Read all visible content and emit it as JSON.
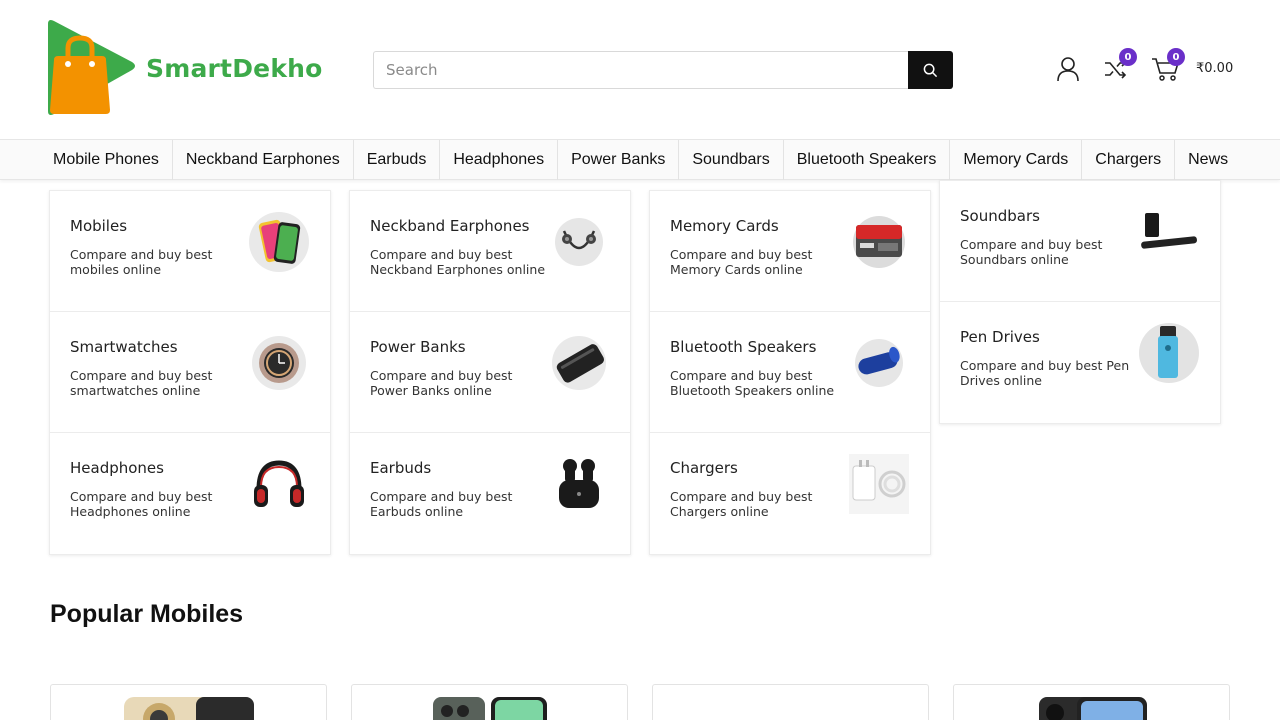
{
  "brand": {
    "name": "SmartDekho",
    "color": "#3daa4a",
    "accent": "#f39200"
  },
  "search": {
    "placeholder": "Search",
    "value": ""
  },
  "header": {
    "compare_count": "0",
    "cart_count": "0",
    "cart_total": "₹0.00",
    "badge_color": "#6a2fc9"
  },
  "nav": {
    "items": [
      "Mobile Phones",
      "Neckband Earphones",
      "Earbuds",
      "Headphones",
      "Power Banks",
      "Soundbars",
      "Bluetooth Speakers",
      "Memory Cards",
      "Chargers",
      "News"
    ]
  },
  "categories": {
    "col1": [
      {
        "title": "Mobiles",
        "desc": "Compare and buy best mobiles online",
        "icon": "mobile-phone-icon"
      },
      {
        "title": "Smartwatches",
        "desc": "Compare and buy best smartwatches online",
        "icon": "smartwatch-icon"
      },
      {
        "title": "Headphones",
        "desc": "Compare and buy best Headphones online",
        "icon": "headphones-icon"
      }
    ],
    "col2": [
      {
        "title": "Neckband Earphones",
        "desc": "Compare and buy best Neckband Earphones online",
        "icon": "neckband-icon"
      },
      {
        "title": "Power Banks",
        "desc": "Compare and buy best Power Banks online",
        "icon": "power-bank-icon"
      },
      {
        "title": "Earbuds",
        "desc": "Compare and buy best Earbuds online",
        "icon": "earbuds-icon"
      }
    ],
    "col3": [
      {
        "title": "Memory Cards",
        "desc": "Compare and buy best Memory Cards online",
        "icon": "memory-card-icon"
      },
      {
        "title": "Bluetooth Speakers",
        "desc": "Compare and buy best Bluetooth Speakers online",
        "icon": "speaker-icon"
      },
      {
        "title": "Chargers",
        "desc": "Compare and buy best Chargers online",
        "icon": "charger-icon"
      }
    ],
    "col4": [
      {
        "title": "Soundbars",
        "desc": "Compare and buy best Soundbars online",
        "icon": "soundbar-icon"
      },
      {
        "title": "Pen Drives",
        "desc": "Compare and buy best Pen Drives online",
        "icon": "pen-drive-icon"
      }
    ]
  },
  "popular": {
    "title": "Popular Mobiles"
  }
}
